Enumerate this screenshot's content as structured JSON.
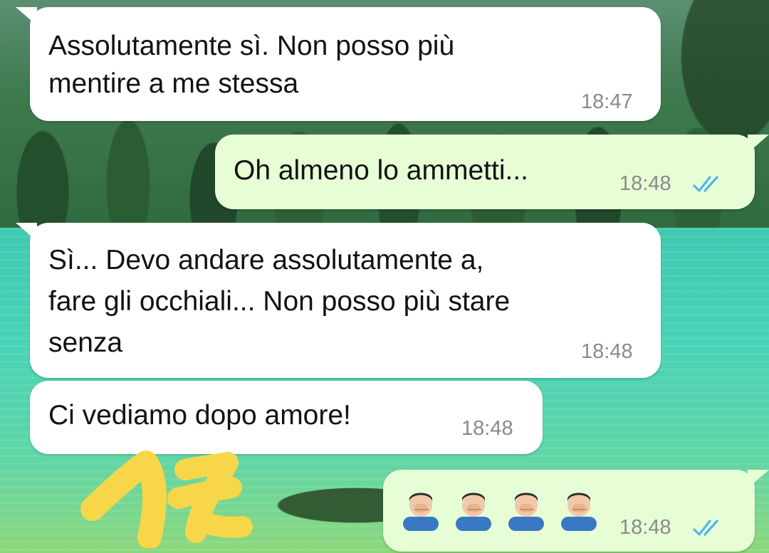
{
  "messages": [
    {
      "direction": "incoming",
      "text": "Assolutamente sì. Non posso più\nmentire a me stessa",
      "time": "18:47"
    },
    {
      "direction": "outgoing",
      "text": "Oh almeno lo ammetti...",
      "time": "18:48",
      "status": "read"
    },
    {
      "direction": "incoming",
      "text": "Sì... Devo andare assolutamente a,\nfare gli occhiali... Non posso più stare\nsenza",
      "time": "18:48"
    },
    {
      "direction": "incoming",
      "text": "Ci vediamo dopo amore!",
      "time": "18:48"
    },
    {
      "direction": "outgoing",
      "emoji": [
        "man-facepalming",
        "man-facepalming",
        "man-facepalming",
        "man-facepalming"
      ],
      "time": "18:48",
      "status": "read"
    }
  ],
  "colors": {
    "incoming_bubble": "#ffffff",
    "outgoing_bubble": "#e7fdd6",
    "read_ticks": "#4fb6ec",
    "timestamp": "#8a8a8a",
    "scribble": "#f7d64a"
  },
  "icons": {
    "read_receipt": "double-check-icon",
    "emoji": "man-facepalming-emoji"
  }
}
